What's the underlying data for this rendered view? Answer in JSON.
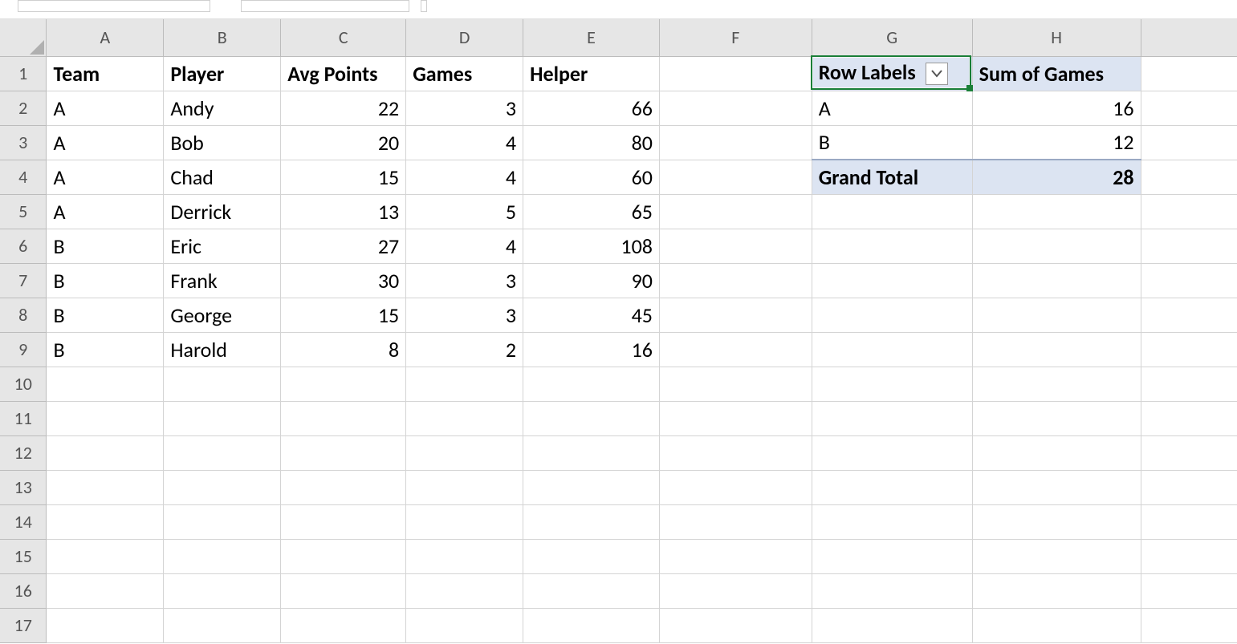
{
  "columns": [
    "A",
    "B",
    "C",
    "D",
    "E",
    "F",
    "G",
    "H"
  ],
  "rowCount": 17,
  "table": {
    "headers": {
      "team": "Team",
      "player": "Player",
      "avgPoints": "Avg Points",
      "games": "Games",
      "helper": "Helper"
    },
    "rows": [
      {
        "team": "A",
        "player": "Andy",
        "avgPoints": 22,
        "games": 3,
        "helper": 66
      },
      {
        "team": "A",
        "player": "Bob",
        "avgPoints": 20,
        "games": 4,
        "helper": 80
      },
      {
        "team": "A",
        "player": "Chad",
        "avgPoints": 15,
        "games": 4,
        "helper": 60
      },
      {
        "team": "A",
        "player": "Derrick",
        "avgPoints": 13,
        "games": 5,
        "helper": 65
      },
      {
        "team": "B",
        "player": "Eric",
        "avgPoints": 27,
        "games": 4,
        "helper": 108
      },
      {
        "team": "B",
        "player": "Frank",
        "avgPoints": 30,
        "games": 3,
        "helper": 90
      },
      {
        "team": "B",
        "player": "George",
        "avgPoints": 15,
        "games": 3,
        "helper": 45
      },
      {
        "team": "B",
        "player": "Harold",
        "avgPoints": 8,
        "games": 2,
        "helper": 16
      }
    ]
  },
  "pivot": {
    "headerLeft": "Row Labels",
    "headerRight": "Sum of Games",
    "rows": [
      {
        "label": "A",
        "value": 16
      },
      {
        "label": "B",
        "value": 12
      }
    ],
    "total": {
      "label": "Grand Total",
      "value": 28
    }
  },
  "activeCell": "G1"
}
